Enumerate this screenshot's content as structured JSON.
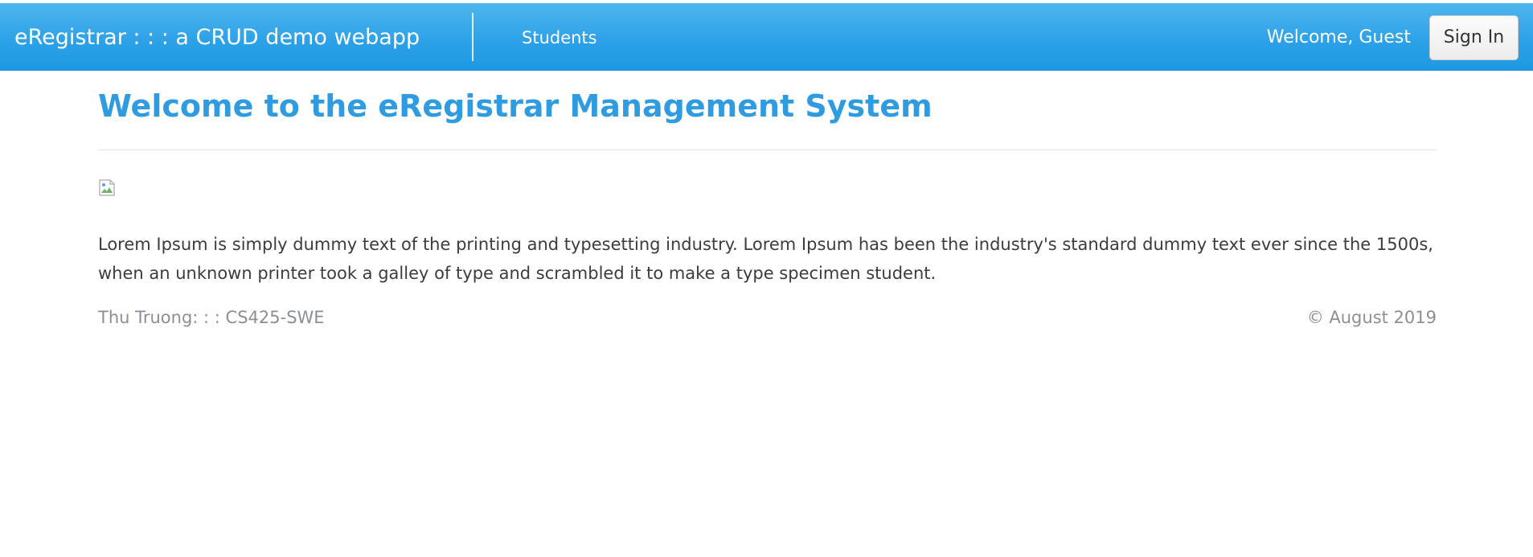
{
  "navbar": {
    "brand": "eRegistrar : : : a CRUD demo webapp",
    "links": [
      {
        "label": "Students"
      }
    ],
    "welcome": "Welcome, Guest",
    "sign_in_label": "Sign In"
  },
  "main": {
    "title": "Welcome to the eRegistrar Management System",
    "image_icon": "broken-image-icon",
    "intro": "Lorem Ipsum is simply dummy text of the printing and typesetting industry. Lorem Ipsum has been the industry's standard dummy text ever since the 1500s, when an unknown printer took a galley of type and scrambled it to make a type specimen student."
  },
  "footer": {
    "left": "Thu Truong: : : CS425-SWE",
    "right": "© August 2019"
  },
  "colors": {
    "navbar": "#2ba0e8",
    "title": "#2f9be0",
    "footer_text": "#8a8f96"
  }
}
